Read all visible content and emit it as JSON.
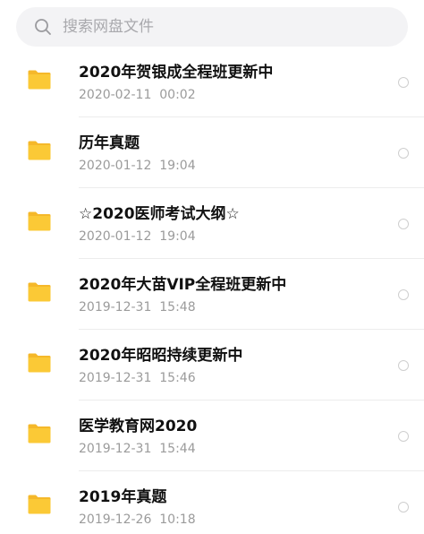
{
  "search": {
    "placeholder": "搜索网盘文件",
    "value": ""
  },
  "colors": {
    "folder": "#fbc936",
    "folder_tab": "#f5b82a",
    "search_bg": "#f3f3f5",
    "divider": "#ececec"
  },
  "files": [
    {
      "icon": "folder-icon",
      "name": "2020年贺银成全程班更新中",
      "date": "2020-02-11  00:02"
    },
    {
      "icon": "folder-icon",
      "name": "历年真题",
      "date": "2020-01-12  19:04"
    },
    {
      "icon": "folder-icon",
      "name": "☆2020医师考试大纲☆",
      "date": "2020-01-12  19:04"
    },
    {
      "icon": "folder-icon",
      "name": "2020年大苗VIP全程班更新中",
      "date": "2019-12-31  15:48"
    },
    {
      "icon": "folder-icon",
      "name": "2020年昭昭持续更新中",
      "date": "2019-12-31  15:46"
    },
    {
      "icon": "folder-icon",
      "name": "医学教育网2020",
      "date": "2019-12-31  15:44"
    },
    {
      "icon": "folder-icon",
      "name": "2019年真题",
      "date": "2019-12-26  10:18"
    }
  ]
}
